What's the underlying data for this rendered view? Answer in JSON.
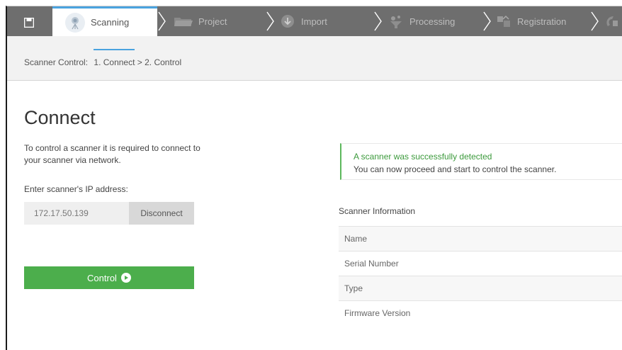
{
  "nav": {
    "tabs": [
      {
        "label": "Scanning",
        "icon": "scanner-icon",
        "active": true
      },
      {
        "label": "Project",
        "icon": "folder-icon"
      },
      {
        "label": "Import",
        "icon": "import-icon"
      },
      {
        "label": "Processing",
        "icon": "processing-icon"
      },
      {
        "label": "Registration",
        "icon": "registration-icon"
      }
    ]
  },
  "breadcrumb": {
    "prefix": "Scanner Control:",
    "step1": "1. Connect",
    "separator": " > ",
    "step2": "2. Control"
  },
  "connect": {
    "heading": "Connect",
    "description": "To control a scanner it is required to connect to your scanner via network.",
    "ip_label": "Enter scanner's IP address:",
    "ip_value": "172.17.50.139",
    "disconnect_label": "Disconnect",
    "control_label": "Control"
  },
  "alert": {
    "title": "A scanner was successfully detected",
    "body": "You can now proceed and start to control the scanner."
  },
  "scanner_info": {
    "title": "Scanner Information",
    "rows": [
      "Name",
      "Serial Number",
      "Type",
      "Firmware Version"
    ]
  },
  "colors": {
    "nav_bg": "#6e6e6e",
    "accent_blue": "#4aa3df",
    "success_green": "#4cae4c"
  }
}
